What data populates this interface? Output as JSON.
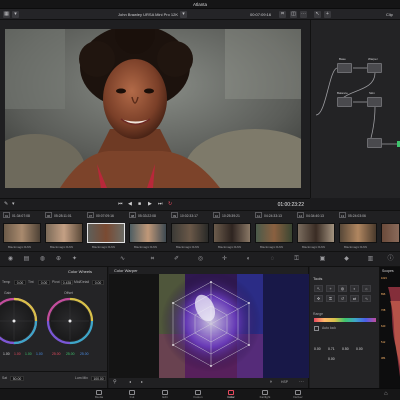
{
  "window": {
    "title": "Atlanta"
  },
  "toolbar": {
    "camera": "John Brawley URSA Mini Pro 12K",
    "timecode": "00:07:09:16",
    "clip_label": "Clip"
  },
  "viewer": {
    "timecode": "01:00:23:22"
  },
  "nodes": [
    {
      "num": "01",
      "label": "Base"
    },
    {
      "num": "02",
      "label": "Warper"
    },
    {
      "num": "03",
      "label": "Balance"
    },
    {
      "num": "04",
      "label": "Skin"
    },
    {
      "num": "05",
      "label": ""
    },
    {
      "num": "06",
      "label": ""
    }
  ],
  "clips": [
    {
      "num": "01",
      "tc": "01:34:07:08",
      "codec": "Blackmagic RAW"
    },
    {
      "num": "06",
      "tc": "05:28:11:01",
      "codec": "Blackmagic RAW"
    },
    {
      "num": "07",
      "tc": "00:07:09:16",
      "codec": "Blackmagic RAW"
    },
    {
      "num": "08",
      "tc": "05:33:22:08",
      "codec": "Blackmagic RAW"
    },
    {
      "num": "09",
      "tc": "10:02:33:17",
      "codec": "Blackmagic RAW"
    },
    {
      "num": "10",
      "tc": "10:25:39:21",
      "codec": "Blackmagic RAW"
    },
    {
      "num": "11",
      "tc": "04:24:33:13",
      "codec": "Blackmagic RAW"
    },
    {
      "num": "12",
      "tc": "04:34:40:13",
      "codec": "Blackmagic RAW"
    },
    {
      "num": "13",
      "tc": "05:24:03:06",
      "codec": "Blackmagic RAW"
    }
  ],
  "wheels": {
    "title": "Color Wheels",
    "temp_label": "Temp",
    "temp_value": "0.00",
    "tint_label": "Tint",
    "tint_value": "0.00",
    "pivot_label": "Pivot",
    "pivot_value": "0.435",
    "midsat_label": "Mid/Detail",
    "midsat_value": "0.00",
    "gain_label": "Gain",
    "offset_label": "Offset",
    "gain_values": [
      "1.00",
      "1.00",
      "1.00",
      "1.00"
    ],
    "offset_values": [
      "25.00",
      "25.00",
      "25.00"
    ],
    "sat_label": "Sat",
    "sat_value": "50.00",
    "lummix_label": "Lum Mix",
    "lummix_value": "100.00"
  },
  "warper": {
    "title": "Color Warper",
    "hsp_label": "HSP"
  },
  "tools": {
    "title": "Tools",
    "range_label": "Range",
    "autolock_label": "Auto lock",
    "values": [
      "0.00",
      "0.71",
      "0.50",
      "0.00",
      "0.00"
    ]
  },
  "scopes": {
    "title": "Scopes",
    "scale": [
      "1023",
      "896",
      "768",
      "640",
      "512",
      "384"
    ]
  },
  "pages": [
    {
      "label": "Media",
      "active": false
    },
    {
      "label": "Cut",
      "active": false
    },
    {
      "label": "Edit",
      "active": false
    },
    {
      "label": "Fusion",
      "active": false
    },
    {
      "label": "Color",
      "active": true
    },
    {
      "label": "Fairlight",
      "active": false
    },
    {
      "label": "Deliver",
      "active": false
    }
  ],
  "colors": {
    "accent": "#e84a5f",
    "highlight": "#ffb86b"
  }
}
